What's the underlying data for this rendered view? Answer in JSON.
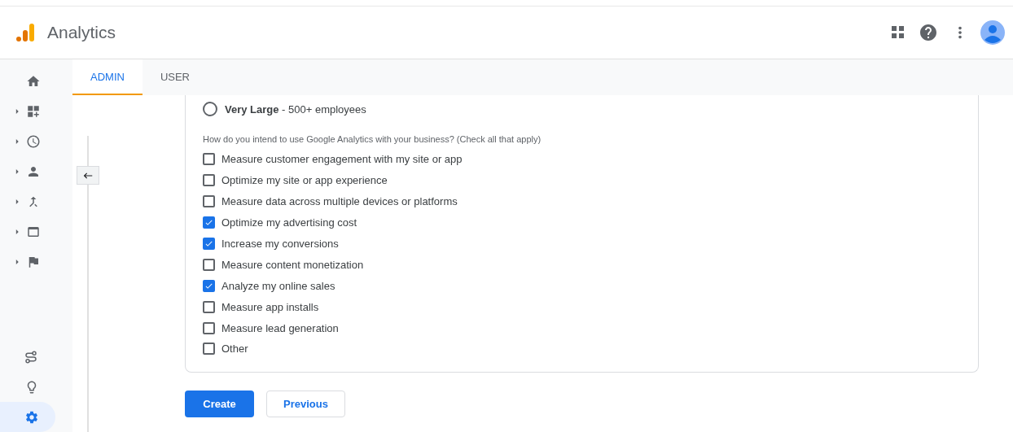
{
  "header": {
    "title": "Analytics"
  },
  "sidebar": {
    "top_items": [
      {
        "expandable": false,
        "selected": false
      },
      {
        "expandable": true,
        "selected": false
      },
      {
        "expandable": true,
        "selected": false
      },
      {
        "expandable": true,
        "selected": false
      },
      {
        "expandable": true,
        "selected": false
      },
      {
        "expandable": true,
        "selected": false
      },
      {
        "expandable": true,
        "selected": false
      }
    ],
    "bottom_items": [
      {
        "selected": false
      },
      {
        "selected": false
      },
      {
        "selected": true
      }
    ]
  },
  "tabs": [
    {
      "label": "ADMIN",
      "selected": true
    },
    {
      "label": "USER",
      "selected": false
    }
  ],
  "form": {
    "radio": {
      "label": "**Very Large** - 500+ employees",
      "selected": false
    },
    "question": "How do you intend to use Google Analytics with your business? (Check all that apply)",
    "options": [
      {
        "label": "Measure customer engagement with my site or app",
        "checked": false
      },
      {
        "label": "Optimize my site or app experience",
        "checked": false
      },
      {
        "label": "Measure data across multiple devices or platforms",
        "checked": false
      },
      {
        "label": "Optimize my advertising cost",
        "checked": true
      },
      {
        "label": "Increase my conversions",
        "checked": true
      },
      {
        "label": "Measure content monetization",
        "checked": false
      },
      {
        "label": "Analyze my online sales",
        "checked": true
      },
      {
        "label": "Measure app installs",
        "checked": false
      },
      {
        "label": "Measure lead generation",
        "checked": false
      },
      {
        "label": "Other",
        "checked": false
      }
    ]
  },
  "buttons": {
    "primary": "Create",
    "secondary": "Previous"
  }
}
